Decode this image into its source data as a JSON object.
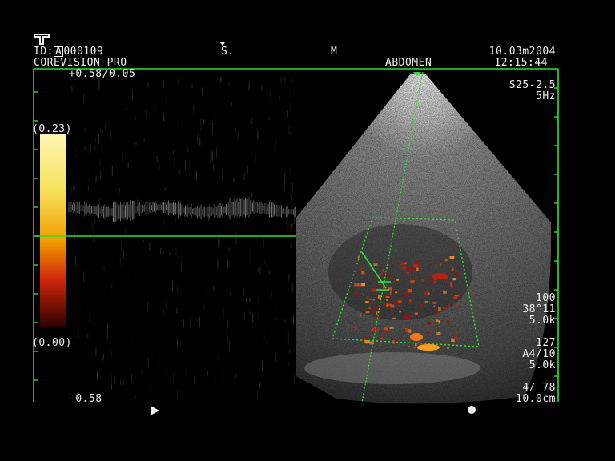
{
  "header": {
    "patient_id_prefix": "ID:",
    "patient_id_boxed": "A",
    "patient_id_rest": "000109",
    "system_name": "COREVISION PRO",
    "marker_s": "S.",
    "marker_m": "M",
    "exam_type": "ABDOMEN",
    "date": "10.03m2004",
    "time": "12:15:44"
  },
  "doppler": {
    "scale_top": "+0.58/0.05",
    "scale_bottom": "-0.58",
    "colorbar_max": "(0.23)",
    "colorbar_min": "(0.00)"
  },
  "probe": {
    "model": "S25-2.5",
    "frame_rate": "5Hz"
  },
  "settings_block1": {
    "line1": "100",
    "line2": "38°11",
    "line3": "5.0k"
  },
  "settings_block2": {
    "line1": "127",
    "line2": "A4/10",
    "line3": "5.0k"
  },
  "depth": {
    "frame_counter": "4/ 78",
    "depth_value": "10.0cm"
  },
  "icons": {
    "logo": "ultrasound-logo-icon",
    "play": "play-triangle-icon",
    "dot": "marker-dot-icon"
  },
  "colors": {
    "frame": "#2ee02e",
    "text": "#f2f2f2",
    "colorbar_top": "#fff7a8",
    "colorbar_mid": "#f2b400",
    "colorbar_low": "#c81e0a"
  }
}
